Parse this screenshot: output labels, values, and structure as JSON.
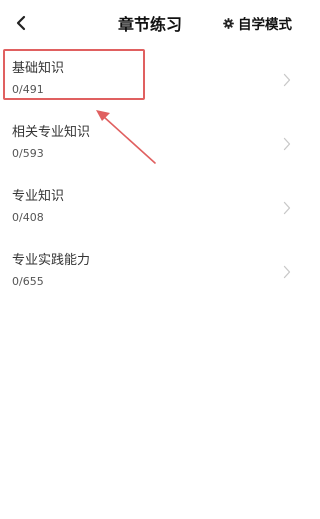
{
  "header": {
    "title": "章节练习",
    "mode_label": "自学模式",
    "back_icon": "chevron-left-icon",
    "mode_icon": "gear-icon"
  },
  "chapters": [
    {
      "name": "基础知识",
      "progress": "0/491"
    },
    {
      "name": "相关专业知识",
      "progress": "0/593"
    },
    {
      "name": "专业知识",
      "progress": "0/408"
    },
    {
      "name": "专业实践能力",
      "progress": "0/655"
    }
  ],
  "annotation": {
    "color": "#e06060"
  }
}
